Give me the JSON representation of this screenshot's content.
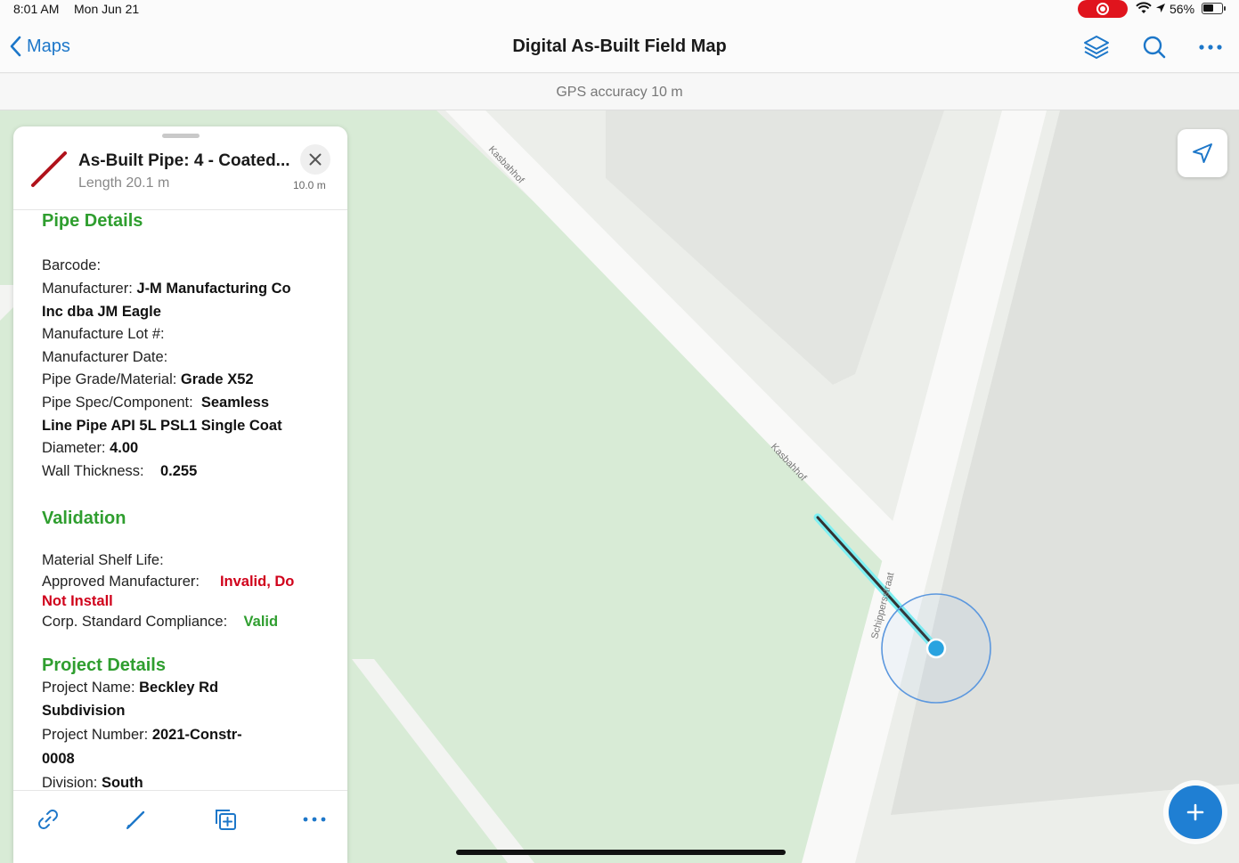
{
  "status_bar": {
    "time": "8:01 AM",
    "date": "Mon Jun 21",
    "battery": "56%"
  },
  "nav": {
    "back_label": "Maps",
    "title": "Digital As-Built Field Map"
  },
  "gps": {
    "text": "GPS accuracy 10 m"
  },
  "map": {
    "street_1": "Kasbahhof",
    "street_2": "Kasbahhof",
    "street_3": "Schippersstraat"
  },
  "feature": {
    "title": "As-Built Pipe: 4 - Coated...",
    "length": "Length 20.1 m",
    "distance": "10.0 m"
  },
  "pipe_details": {
    "header": "Pipe Details",
    "barcode_label": "Barcode:",
    "manufacturer_label": "Manufacturer:",
    "manufacturer_value_1": "J-M Manufacturing Co",
    "manufacturer_value_2": "Inc dba JM Eagle",
    "lot_label": "Manufacture Lot #:",
    "date_label": "Manufacturer Date:",
    "grade_label": "Pipe Grade/Material:",
    "grade_value": "Grade X52",
    "spec_label": "Pipe Spec/Component:",
    "spec_value_1": "Seamless",
    "spec_value_2": "Line Pipe API 5L PSL1 Single Coat",
    "diameter_label": "Diameter:",
    "diameter_value": "4.00",
    "wall_label": "Wall Thickness:",
    "wall_value": "0.255"
  },
  "validation": {
    "header": "Validation",
    "shelf_label": "Material Shelf Life:",
    "approved_label": "Approved Manufacturer:",
    "approved_value_1": "Invalid, Do",
    "approved_value_2": "Not Install",
    "compliance_label": "Corp. Standard Compliance:",
    "compliance_value": "Valid"
  },
  "project_details": {
    "header": "Project Details",
    "name_label": "Project Name:",
    "name_value_1": "Beckley Rd",
    "name_value_2": "Subdivision",
    "number_label": "Project Number:",
    "number_value_1": "2021-Constr-",
    "number_value_2": "0008",
    "division_label": "Division:",
    "division_value": "South"
  },
  "colors": {
    "accent": "#1d77c9",
    "section_green": "#2f9e2f",
    "invalid_red": "#d0021b",
    "pipe_red": "#b0121b"
  }
}
